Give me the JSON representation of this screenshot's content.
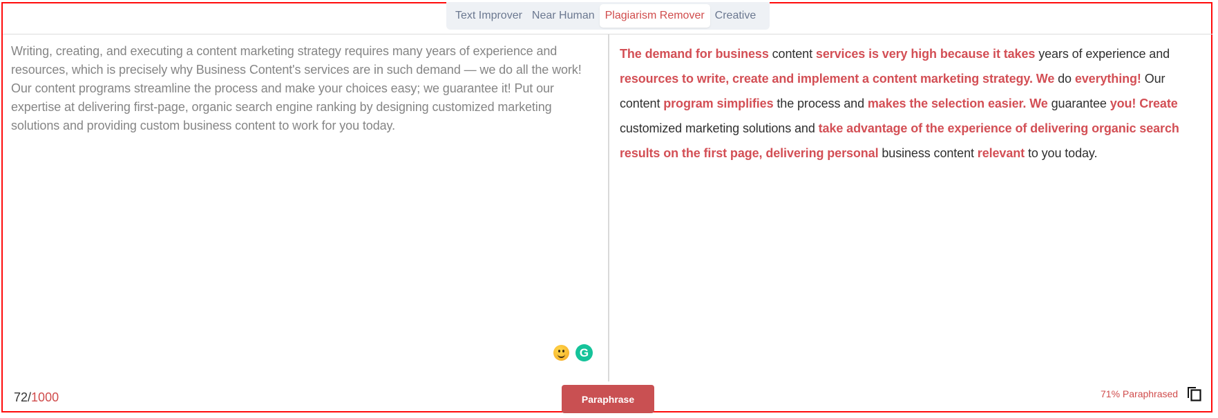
{
  "tabs": [
    {
      "label": "Text Improver",
      "active": false
    },
    {
      "label": "Near Human",
      "active": false
    },
    {
      "label": "Plagiarism Remover",
      "active": true
    },
    {
      "label": "Creative",
      "active": false
    }
  ],
  "input": {
    "text": "Writing, creating, and executing a content marketing strategy requires many years of experience and resources, which is precisely why Business Content's services are in such demand — we do all the work! Our content programs streamline the process and make your choices easy; we guarantee it! Put our expertise at delivering first-page, organic search engine ranking by designing customized marketing solutions and providing custom business content to work for you today."
  },
  "output": {
    "segments": [
      {
        "text": "The demand for business",
        "changed": true
      },
      {
        "text": " content ",
        "changed": false
      },
      {
        "text": "services is very high because it takes",
        "changed": true
      },
      {
        "text": " years of experience and ",
        "changed": false
      },
      {
        "text": "resources to write, create and implement a content marketing strategy. We",
        "changed": true
      },
      {
        "text": " do ",
        "changed": false
      },
      {
        "text": "everything!",
        "changed": true
      },
      {
        "text": " Our content ",
        "changed": false
      },
      {
        "text": "program simplifies",
        "changed": true
      },
      {
        "text": " the process and ",
        "changed": false
      },
      {
        "text": "makes the selection easier. We",
        "changed": true
      },
      {
        "text": " guarantee ",
        "changed": false
      },
      {
        "text": "you! Create",
        "changed": true
      },
      {
        "text": " customized marketing solutions and ",
        "changed": false
      },
      {
        "text": "take advantage of the experience of delivering organic search results on the first page, delivering personal",
        "changed": true
      },
      {
        "text": " business content ",
        "changed": false
      },
      {
        "text": "relevant",
        "changed": true
      },
      {
        "text": " to you today.",
        "changed": false
      }
    ]
  },
  "icons": {
    "emoji": "smiley-emoji-icon",
    "grammarly": "grammarly-icon",
    "grammarly_glyph": "G",
    "copy": "copy-icon"
  },
  "footer": {
    "word_count": "72",
    "separator": "/",
    "word_limit": "1000",
    "paraphrase_button": "Paraphrase",
    "paraphrased_percent": "71% Paraphrased"
  },
  "colors": {
    "accent": "#d04c4c",
    "button": "#c95052",
    "frame_border": "#ff0a0a",
    "grammarly": "#15c39a"
  }
}
